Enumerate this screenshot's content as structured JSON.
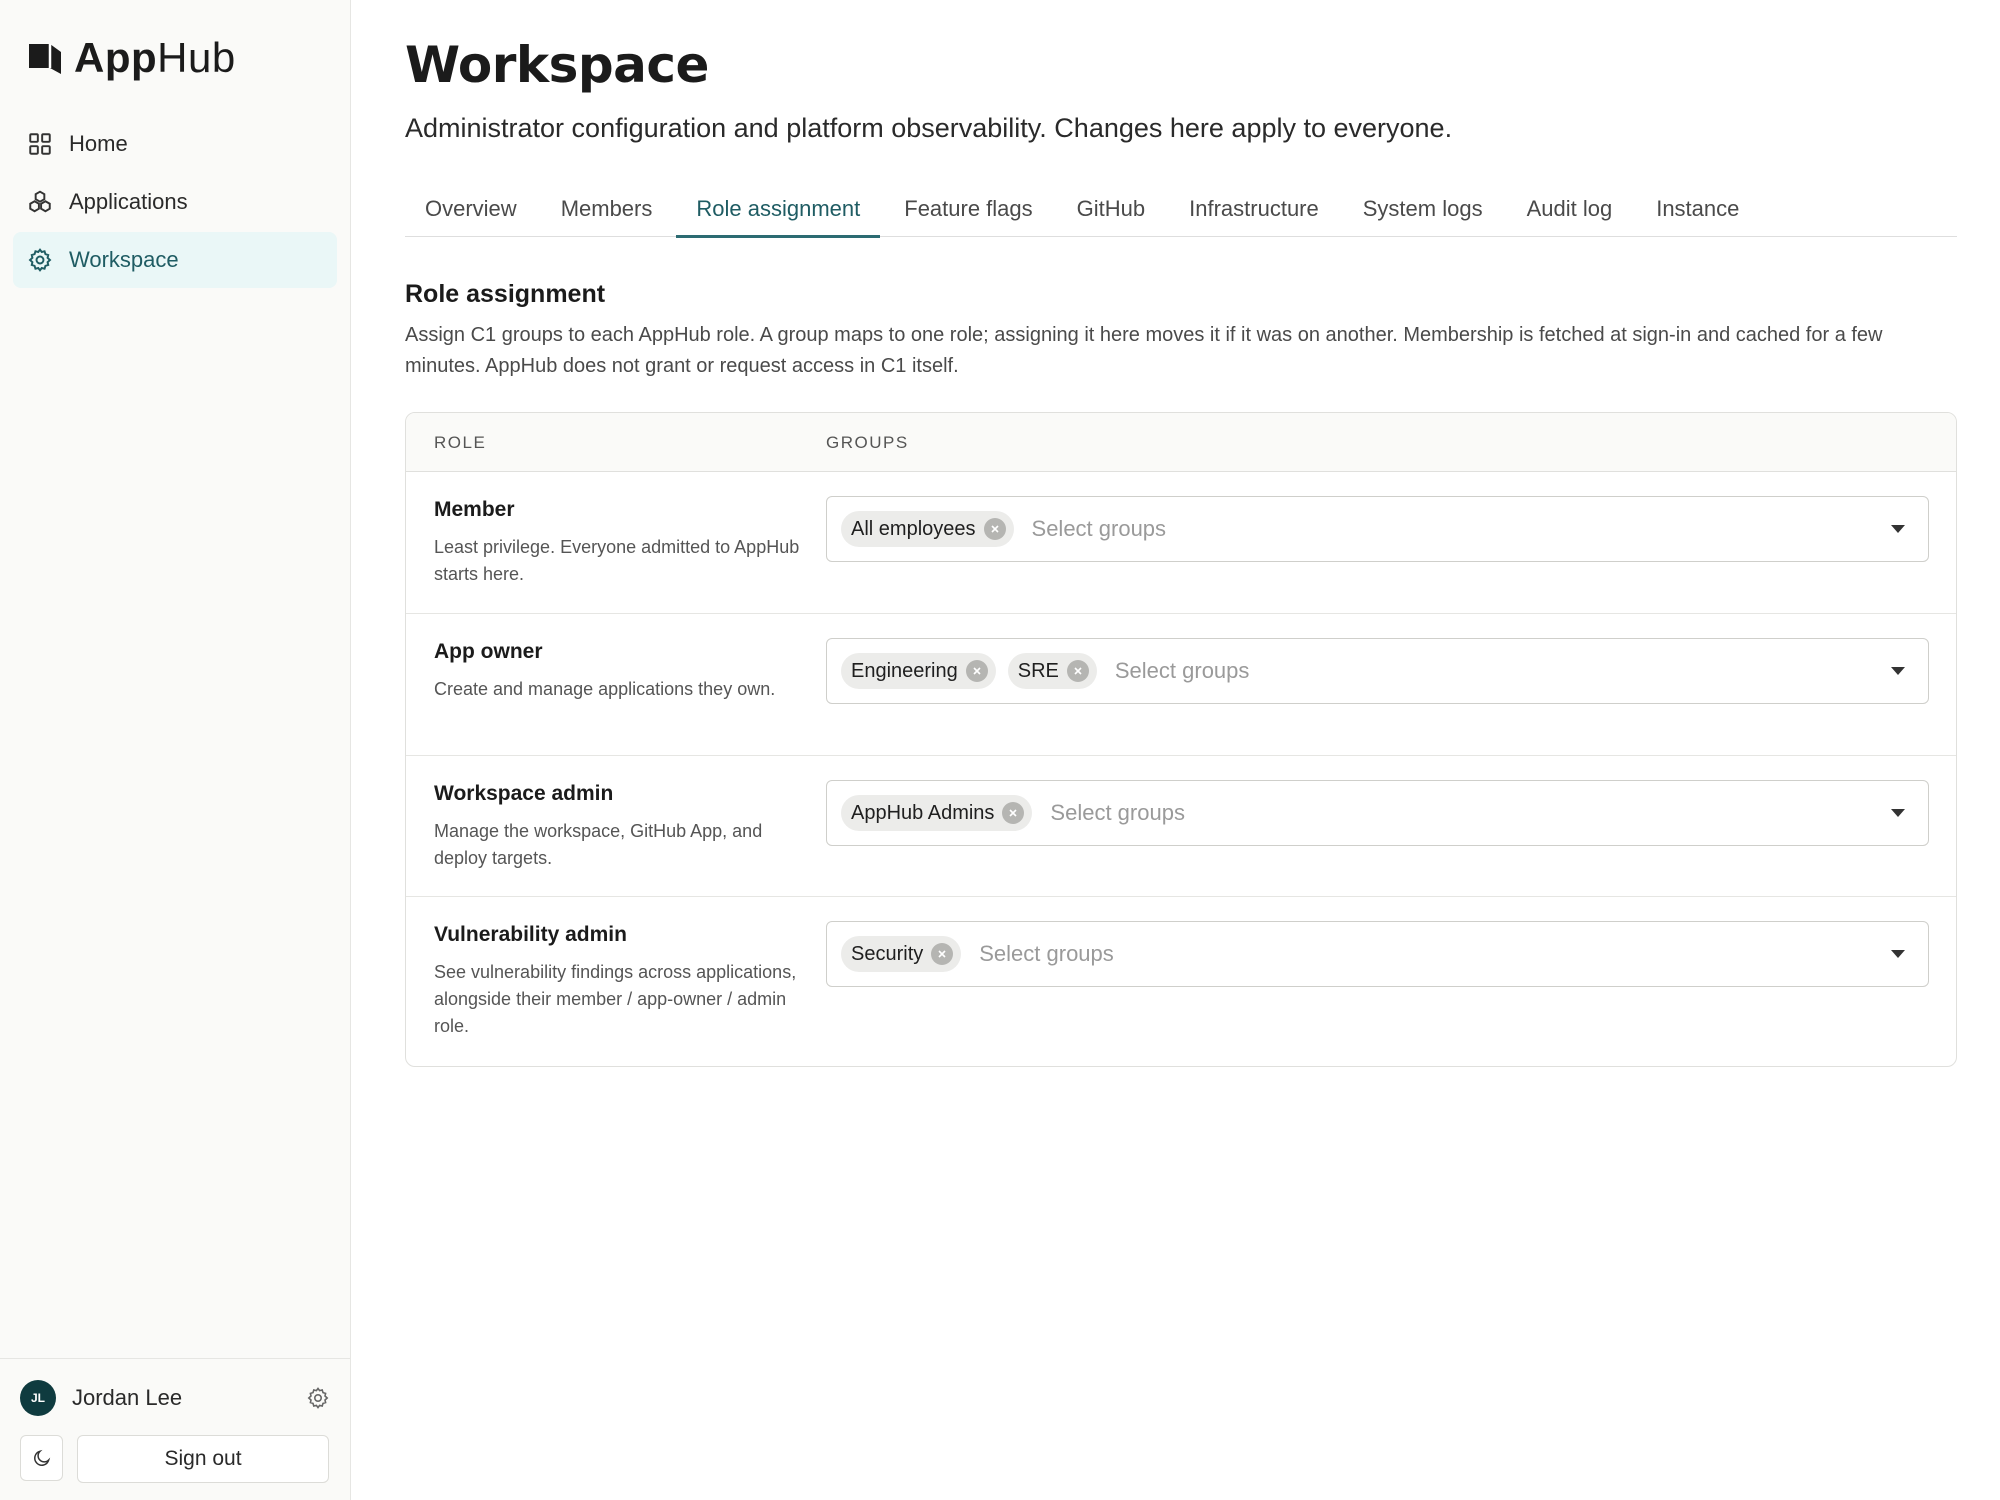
{
  "app": {
    "name_strong": "App",
    "name_light": "Hub"
  },
  "sidebar": {
    "items": [
      {
        "label": "Home",
        "icon": "grid-icon",
        "active": false
      },
      {
        "label": "Applications",
        "icon": "apps-icon",
        "active": false
      },
      {
        "label": "Workspace",
        "icon": "gear-icon",
        "active": true
      }
    ],
    "user": {
      "initials": "JL",
      "name": "Jordan Lee"
    },
    "sign_out_label": "Sign out"
  },
  "page": {
    "title": "Workspace",
    "subtitle": "Administrator configuration and platform observability. Changes here apply to everyone."
  },
  "tabs": [
    {
      "label": "Overview",
      "active": false
    },
    {
      "label": "Members",
      "active": false
    },
    {
      "label": "Role assignment",
      "active": true
    },
    {
      "label": "Feature flags",
      "active": false
    },
    {
      "label": "GitHub",
      "active": false
    },
    {
      "label": "Infrastructure",
      "active": false
    },
    {
      "label": "System logs",
      "active": false
    },
    {
      "label": "Audit log",
      "active": false
    },
    {
      "label": "Instance",
      "active": false
    }
  ],
  "section": {
    "title": "Role assignment",
    "description": "Assign C1 groups to each AppHub role. A group maps to one role; assigning it here moves it if it was on another. Membership is fetched at sign-in and cached for a few minutes. AppHub does not grant or request access in C1 itself."
  },
  "table": {
    "headers": {
      "role": "ROLE",
      "groups": "GROUPS"
    },
    "rows": [
      {
        "role": "Member",
        "description": "Least privilege. Everyone admitted to AppHub starts here.",
        "groups": [
          "All employees"
        ],
        "placeholder": "Select groups"
      },
      {
        "role": "App owner",
        "description": "Create and manage applications they own.",
        "groups": [
          "Engineering",
          "SRE"
        ],
        "placeholder": "Select groups"
      },
      {
        "role": "Workspace admin",
        "description": "Manage the workspace, GitHub App, and deploy targets.",
        "groups": [
          "AppHub Admins"
        ],
        "placeholder": "Select groups"
      },
      {
        "role": "Vulnerability admin",
        "description": "See vulnerability findings across applications, alongside their member / app-owner / admin role.",
        "groups": [
          "Security"
        ],
        "placeholder": "Select groups"
      }
    ]
  },
  "colors": {
    "accent": "#2c6b72",
    "accent_text": "#1f5c63",
    "active_nav_bg": "#eaf7f7",
    "avatar_bg": "#0f3b3f"
  }
}
